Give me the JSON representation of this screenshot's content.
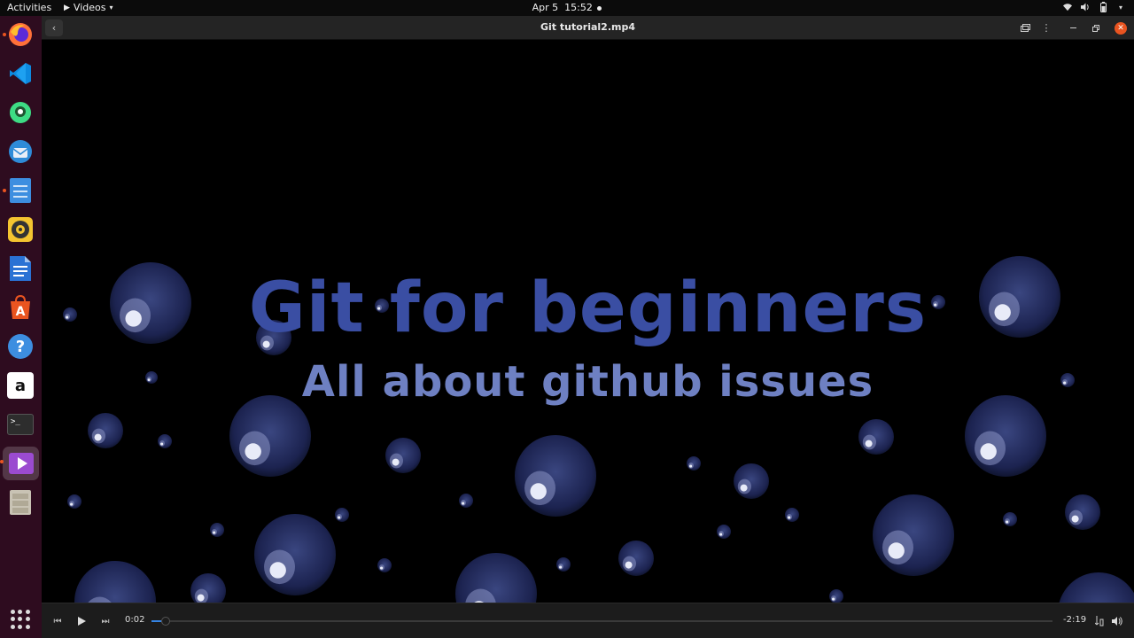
{
  "topbar": {
    "activities": "Activities",
    "app_name": "Videos",
    "date": "Apr 5",
    "time": "15:52"
  },
  "dock": {
    "items": [
      {
        "name": "firefox-icon",
        "color": "#ff7139"
      },
      {
        "name": "vscode-icon",
        "color": "#0d8ae0"
      },
      {
        "name": "android-studio-icon",
        "color": "#3ddc84"
      },
      {
        "name": "thunderbird-icon",
        "color": "#2e8bd8"
      },
      {
        "name": "files-icon",
        "color": "#3d8ee0"
      },
      {
        "name": "rhythmbox-icon",
        "color": "#f4c430"
      },
      {
        "name": "libreoffice-writer-icon",
        "color": "#2a72d4"
      },
      {
        "name": "ubuntu-software-icon",
        "color": "#e95420"
      },
      {
        "name": "help-icon",
        "color": "#3d8ee0"
      },
      {
        "name": "amazon-icon",
        "color": "#ffffff"
      },
      {
        "name": "terminal-icon",
        "color": "#2d2d2d"
      },
      {
        "name": "videos-icon",
        "color": "#9b4bd0"
      },
      {
        "name": "file-cabinet-icon",
        "color": "#c9c3b4"
      }
    ],
    "amazon_label": "a",
    "terminal_label": ">_",
    "help_label": "?"
  },
  "window": {
    "title": "Git tutorial2.mp4"
  },
  "video": {
    "title": "Git for beginners",
    "subtitle": "All about github issues"
  },
  "controls": {
    "elapsed": "0:02",
    "remaining": "-2:19",
    "progress_fraction": 0.011
  },
  "colors": {
    "accent": "#3584e4",
    "close": "#e95420",
    "title_text": "#3a4ea3",
    "subtitle_text": "#6e80c2"
  }
}
